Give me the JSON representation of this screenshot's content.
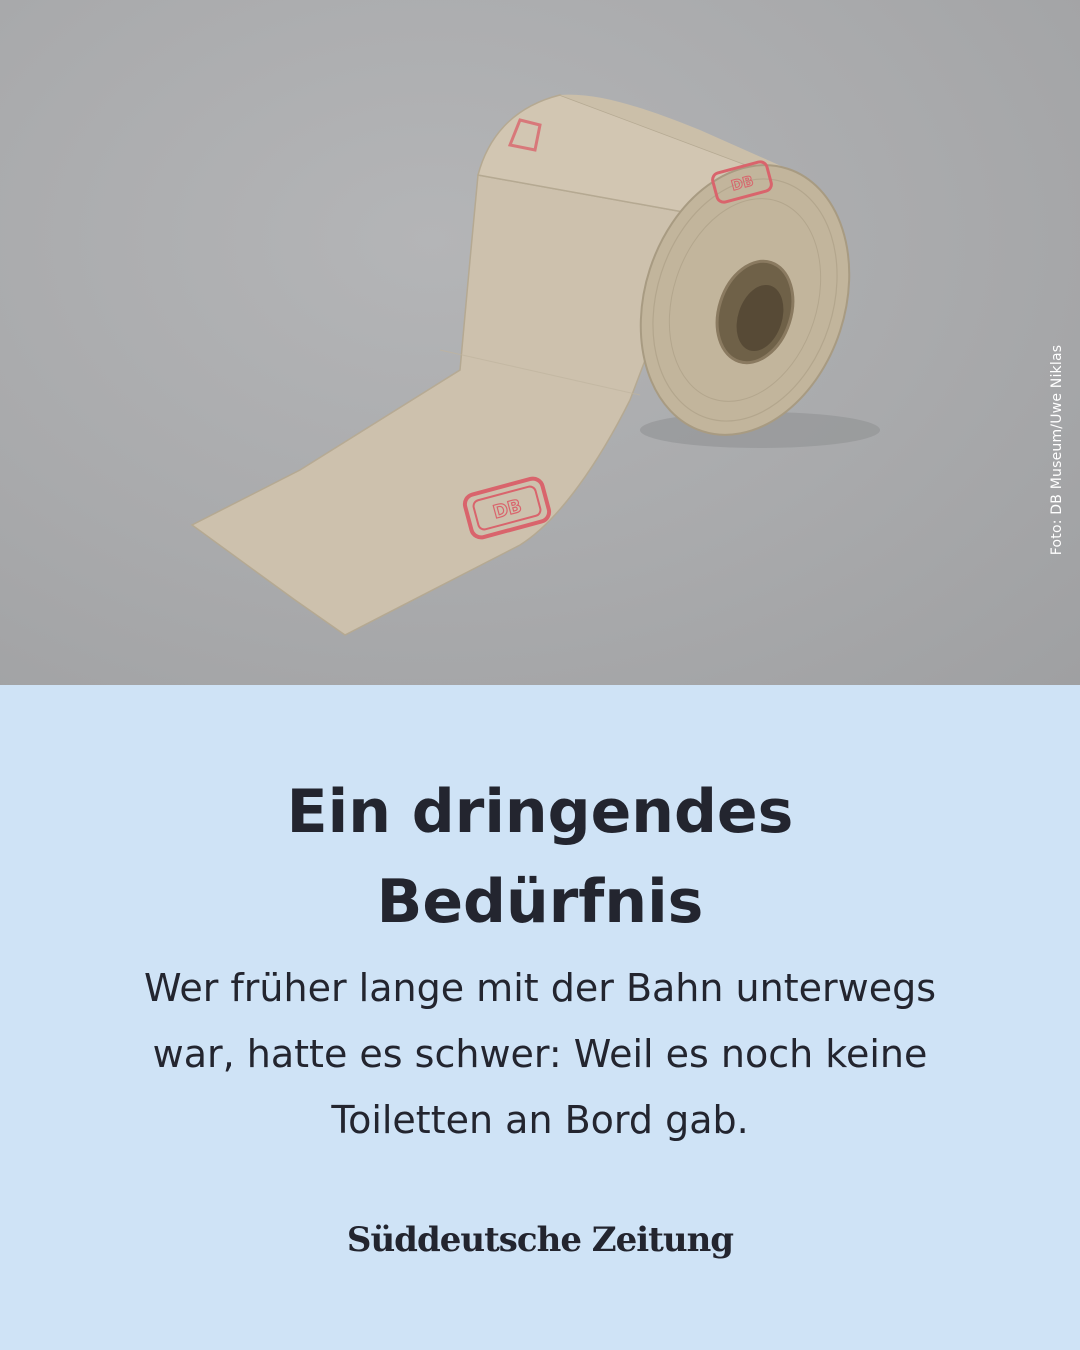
{
  "photo": {
    "subject": "toilet-paper-roll",
    "stamp_text": "DB",
    "credit": "Foto: DB Museum/Uwe Niklas"
  },
  "headline": {
    "line1": "Ein dringendes",
    "line2": "Bedürfnis"
  },
  "dek": {
    "line1": "Wer früher lange mit der Bahn unterwegs",
    "line2": "war, hatte es schwer: Weil es noch keine",
    "line3": "Toiletten an Bord gab."
  },
  "brand": {
    "logo_text": "Süddeutsche Zeitung"
  },
  "colors": {
    "panel_background": "#cfe3f6",
    "text": "#23252f",
    "stamp": "#d9646c"
  }
}
